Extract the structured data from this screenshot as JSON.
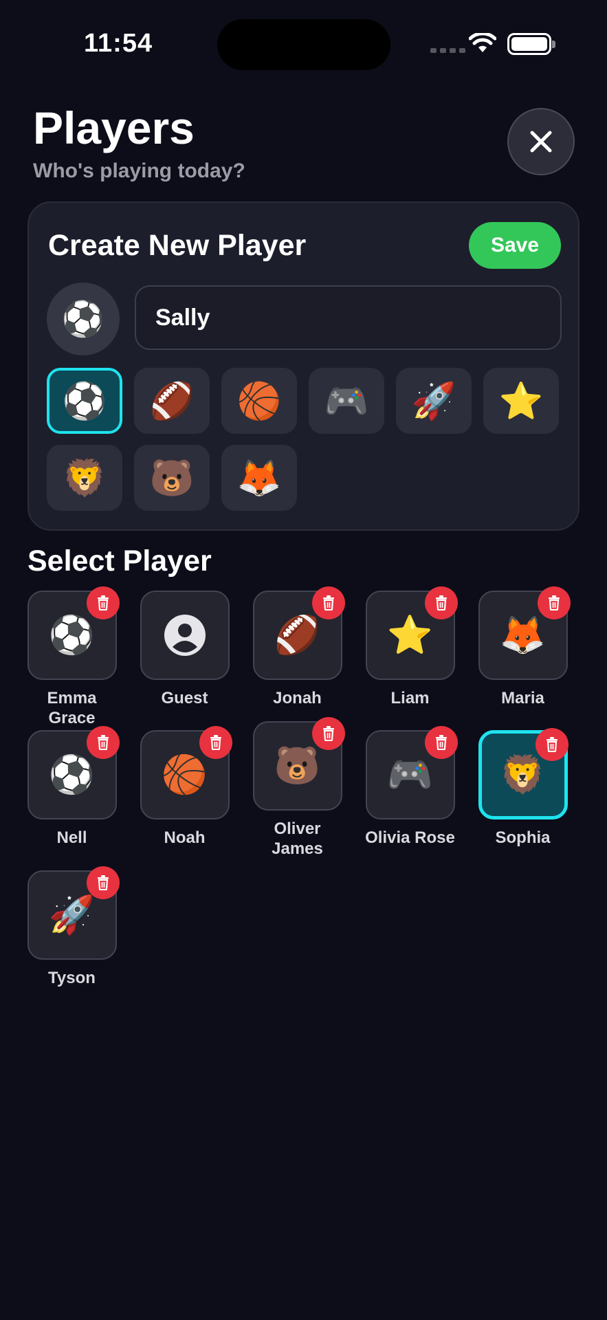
{
  "status": {
    "time": "11:54"
  },
  "header": {
    "title": "Players",
    "subtitle": "Who's playing today?"
  },
  "create": {
    "title": "Create New Player",
    "save_label": "Save",
    "preview_emoji": "⚽",
    "name_value": "Sally",
    "emojis": [
      "⚽",
      "🏈",
      "🏀",
      "🎮",
      "🚀",
      "⭐",
      "🦁",
      "🐻",
      "🦊"
    ],
    "selected_index": 0
  },
  "select": {
    "title": "Select Player",
    "players": [
      {
        "name": "Emma Grace",
        "emoji": "⚽",
        "deletable": true,
        "selected": false
      },
      {
        "name": "Guest",
        "emoji": "person-icon",
        "deletable": false,
        "selected": false
      },
      {
        "name": "Jonah",
        "emoji": "🏈",
        "deletable": true,
        "selected": false
      },
      {
        "name": "Liam",
        "emoji": "⭐",
        "deletable": true,
        "selected": false
      },
      {
        "name": "Maria",
        "emoji": "🦊",
        "deletable": true,
        "selected": false
      },
      {
        "name": "Nell",
        "emoji": "⚽",
        "deletable": true,
        "selected": false
      },
      {
        "name": "Noah",
        "emoji": "🏀",
        "deletable": true,
        "selected": false
      },
      {
        "name": "Oliver\nJames",
        "emoji": "🐻",
        "deletable": true,
        "selected": false
      },
      {
        "name": "Olivia Rose",
        "emoji": "🎮",
        "deletable": true,
        "selected": false
      },
      {
        "name": "Sophia",
        "emoji": "🦁",
        "deletable": true,
        "selected": true
      },
      {
        "name": "Tyson",
        "emoji": "🚀",
        "deletable": true,
        "selected": false
      }
    ]
  },
  "colors": {
    "accent": "#1ee3ee",
    "save": "#33c759",
    "delete": "#e8323f",
    "background": "#0c0d18"
  }
}
